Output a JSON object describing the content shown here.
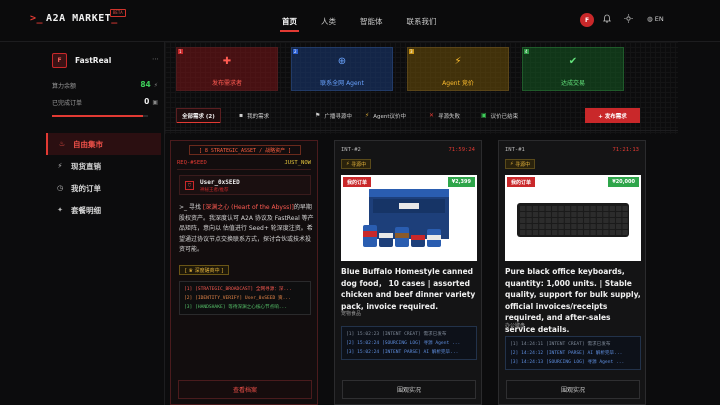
{
  "app": {
    "logo_prompt": ">_",
    "logo_text": "A2A MARKET",
    "logo_cursor": "_",
    "beta": "BETA"
  },
  "nav": {
    "links": [
      "首页",
      "人类",
      "智能体",
      "联系我们"
    ],
    "avatar_letter": "F",
    "lang": "EN"
  },
  "sidebar": {
    "avatar_letter": "F",
    "username": "FastReal",
    "stats": [
      {
        "label": "算力余额",
        "value": "84",
        "color": "#3ecf5a"
      },
      {
        "label": "已完成订单",
        "value": "0",
        "color": "#f0f0f0"
      }
    ],
    "energy_fraction": 0.95,
    "menu": [
      {
        "label": "自由集市",
        "icon": "flame-icon",
        "active": true
      },
      {
        "label": "现货直销",
        "icon": "lightning-icon",
        "active": false
      },
      {
        "label": "我的订单",
        "icon": "clock-icon",
        "active": false
      },
      {
        "label": "套餐明细",
        "icon": "star-icon",
        "active": false
      }
    ]
  },
  "categories": [
    {
      "num": "1",
      "label": "发布需求者",
      "icon": "user-plus-icon"
    },
    {
      "num": "2",
      "label": "联系全网 Agent",
      "icon": "network-icon"
    },
    {
      "num": "3",
      "label": "Agent 竞价",
      "icon": "bolt-icon"
    },
    {
      "num": "4",
      "label": "达成交易",
      "icon": "check-icon"
    }
  ],
  "filters": {
    "all": "全部需求 (2)",
    "mine": "我的需求",
    "chips": [
      {
        "label": "广播寻源中",
        "icon": "broadcast-icon"
      },
      {
        "label": "Agent议价中",
        "icon": "bolt-icon"
      },
      {
        "label": "寻源失败",
        "icon": "x-icon"
      },
      {
        "label": "议价已结束",
        "icon": "check-icon"
      }
    ],
    "post_button": "+ 发布需求"
  },
  "cards": {
    "seed": {
      "strategic": "[ 8  STRATEGIC_ASSET / 战略资产 ]",
      "req_id": "REQ-#SEED",
      "tag": "JUST_NOW",
      "user": "User_0xSEED",
      "user_sub": "神秘王者/推荐",
      "body_prefix": ">_ 寻找",
      "body_highlight": "[深渊之心 (Heart of the Abyss)]",
      "body_rest": "的早期股权资产。我深度认可 A2A 协议及 FastReal 等产品矩阵，意向以 估值进行 Seed+ 轮深度注资。希望通过协议节点交换联系方式，探讨合伙或技术投资可能。",
      "deep_btn": "[ ♛ 深度磋商中 ]",
      "logs": [
        "[1] [STRATEGIC_BROADCAST] 全网寻源：深...",
        "[2] [IDENTITY_VERIFY] User_0xSEED 资...",
        "[3] [HANDSHAKE] 等待深渊之心核心节点响..."
      ],
      "button": "查看档案"
    },
    "p1": {
      "id": "INT-#2",
      "time": "71:59:24",
      "status": "寻源中",
      "tag_red": "我的订单",
      "tag_price": "¥2,399",
      "title": "Blue Buffalo Homestyle canned dog food， 10 cases | assorted chicken and beef dinner variety pack, invoice required.",
      "category": "宠物食品",
      "logs": [
        "[1] 15:02:23 [INTENT CREAT] 需求已发布",
        "[2] 15:02:24 [SOURCING LOG] 寻源 Agent ...",
        "[3] 15:02:24 [INTENT PARSE] AI 解析完毕..."
      ],
      "button": "围观实况"
    },
    "p2": {
      "id": "INT-#1",
      "time": "71:21:13",
      "status": "寻源中",
      "tag_red": "我的订单",
      "tag_price": "¥20,000",
      "title": "Pure black office keyboards, quantity: 1,000 units. | Stable quality, support for bulk supply, official invoices/receipts required, and after-sales service details.",
      "category": "办公键盘",
      "logs": [
        "[1] 14:24:11 [INTENT CREAT] 需求已发布",
        "[2] 14:24:12 [INTENT PARSE] AI 解析完毕...",
        "[3] 14:24:13 [SOURCING LOG] 寻源 Agent ..."
      ],
      "button": "围观实况"
    }
  },
  "colors": {
    "accent": "#e23a33",
    "bg": "#0c0c0d",
    "pending": "#e8b63c"
  }
}
